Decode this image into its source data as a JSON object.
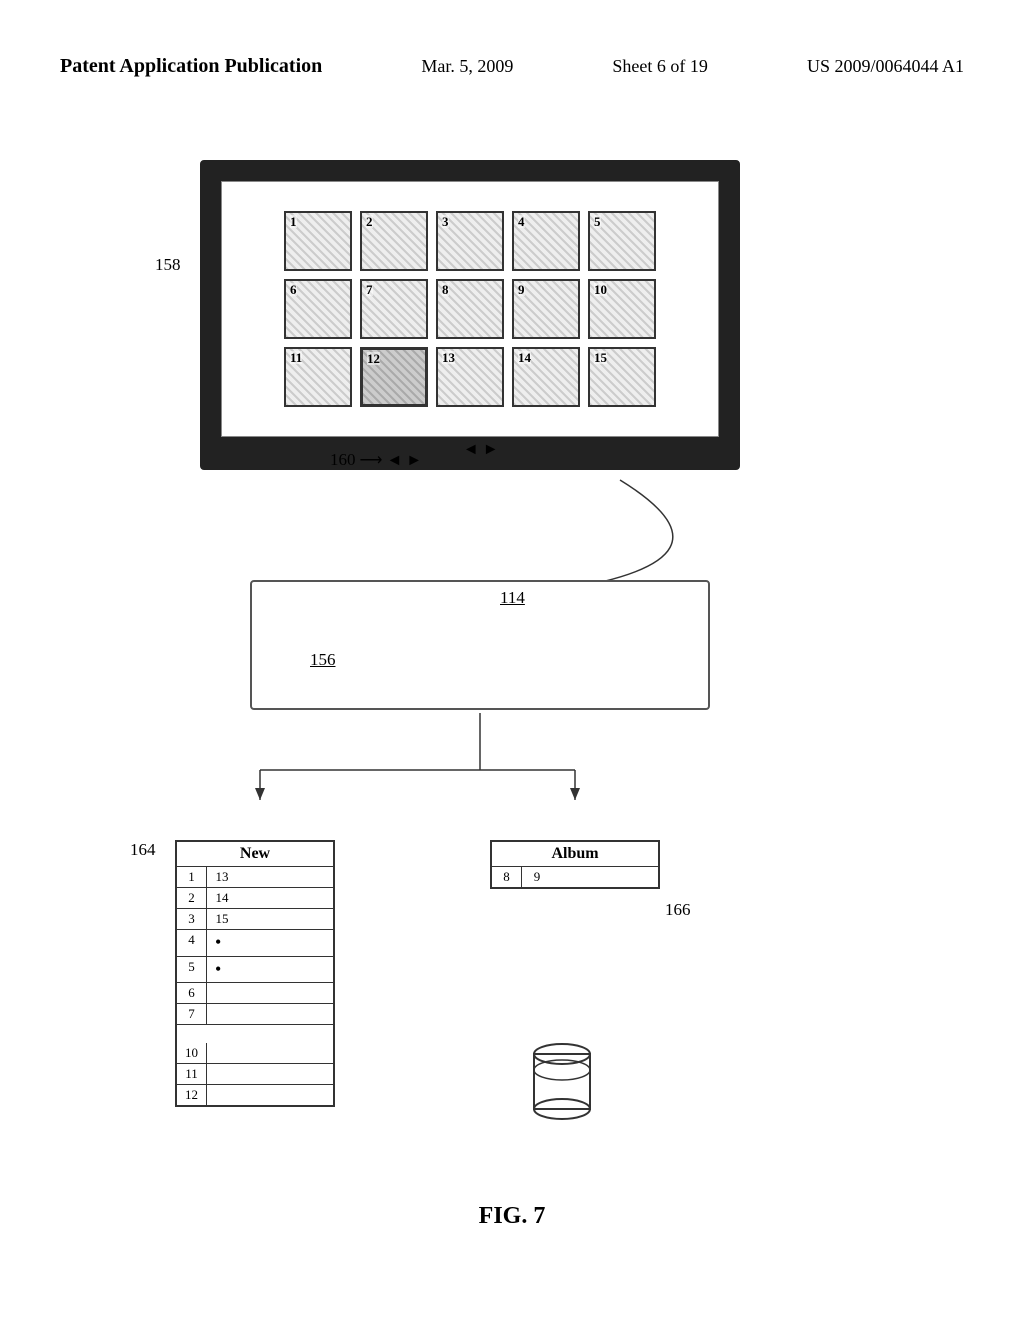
{
  "header": {
    "left": "Patent Application Publication",
    "center": "Mar. 5, 2009",
    "sheet": "Sheet 6 of 19",
    "right": "US 2009/0064044 A1"
  },
  "monitor": {
    "label": "158",
    "grid": {
      "row1": [
        "1",
        "2",
        "3",
        "4",
        "5"
      ],
      "row2": [
        "6",
        "7",
        "8",
        "9",
        "10"
      ],
      "row3": [
        "11",
        "12",
        "13",
        "14",
        "15"
      ]
    },
    "nav_label": "160",
    "selected": "12"
  },
  "db_box": {
    "label": "114",
    "cylinder_label": "156"
  },
  "new_panel": {
    "title": "New",
    "label": "164",
    "rows": [
      {
        "left": "1",
        "right": "13"
      },
      {
        "left": "2",
        "right": "14"
      },
      {
        "left": "3",
        "right": "15"
      },
      {
        "left": "4",
        "right": ""
      },
      {
        "left": "5",
        "right": ""
      },
      {
        "left": "6",
        "right": ""
      },
      {
        "left": "7",
        "right": ""
      }
    ],
    "gap_rows": [
      {
        "left": "10",
        "right": ""
      },
      {
        "left": "11",
        "right": ""
      },
      {
        "left": "12",
        "right": ""
      }
    ]
  },
  "album_panel": {
    "title": "Album",
    "label": "166",
    "rows": [
      {
        "left": "8",
        "right": "9"
      }
    ]
  },
  "fig": "FIG. 7"
}
